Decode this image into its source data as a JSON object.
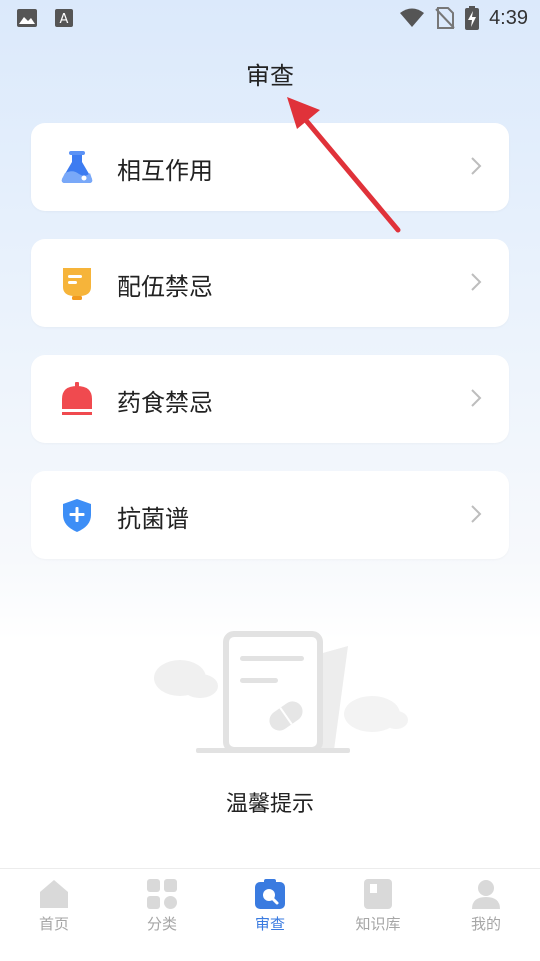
{
  "status_bar": {
    "time": "4:39"
  },
  "header": {
    "title": "审查"
  },
  "menu": {
    "items": [
      {
        "label": "相互作用",
        "icon": "flask-icon"
      },
      {
        "label": "配伍禁忌",
        "icon": "iv-bag-icon"
      },
      {
        "label": "药食禁忌",
        "icon": "bell-icon"
      },
      {
        "label": "抗菌谱",
        "icon": "shield-plus-icon"
      }
    ]
  },
  "tip": {
    "text": "温馨提示"
  },
  "tabbar": {
    "tabs": [
      {
        "label": "首页",
        "icon": "home-icon"
      },
      {
        "label": "分类",
        "icon": "grid-icon"
      },
      {
        "label": "审查",
        "icon": "review-icon",
        "active": true
      },
      {
        "label": "知识库",
        "icon": "book-icon"
      },
      {
        "label": "我的",
        "icon": "user-icon"
      }
    ]
  },
  "colors": {
    "accent": "#3a7be0",
    "arrow": "#e0323a",
    "flask": "#3d7cf1",
    "bag": "#f6b43a",
    "bell": "#f04a4f",
    "shield": "#3d8ef6"
  }
}
